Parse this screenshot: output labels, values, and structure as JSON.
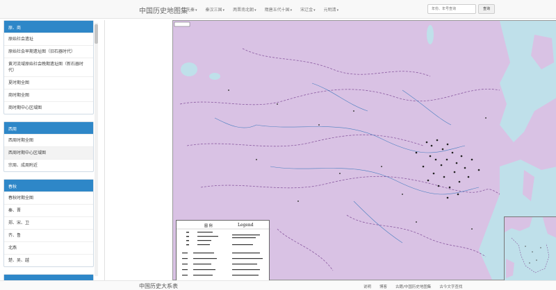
{
  "topbar": {
    "brand": "中国历史地图集",
    "nav": [
      "先秦",
      "秦汉三国",
      "两晋南北朝",
      "隋唐五代十国",
      "宋辽金",
      "元明清"
    ],
    "search_placeholder": "年份、年号查询",
    "search_button": "查询"
  },
  "sidebar": {
    "panels": [
      {
        "title": "原、商",
        "items": [
          "原始社会遗址",
          "原始社会早期遗址图（旧石器时代）",
          "黄河流域原始社会晚期遗址图（新石器时代）",
          "夏时期全图",
          "商时期全图",
          "商时期中心区域图"
        ]
      },
      {
        "title": "西周",
        "items": [
          "西周时期全图",
          "西周时期中心区域图",
          "宗周、成周附近"
        ]
      },
      {
        "title": "春秋",
        "items": [
          "春秋时期全图",
          "秦、晋",
          "郑、宋、卫",
          "齐、鲁",
          "北燕",
          "楚、吴、越"
        ]
      }
    ],
    "active_item": "西周时期中心区域图"
  },
  "map": {
    "legend_title": "Legend",
    "legend_title_cn": "图  例"
  },
  "footer": {
    "brand": "中国历史大系表",
    "links": [
      "说明",
      "博客",
      "古籍/中国历史地图集",
      "古今文字查找"
    ]
  },
  "colors": {
    "accent": "#2e87c8",
    "map_land": "#d9c2e4",
    "map_sea": "#bfe0ea"
  }
}
